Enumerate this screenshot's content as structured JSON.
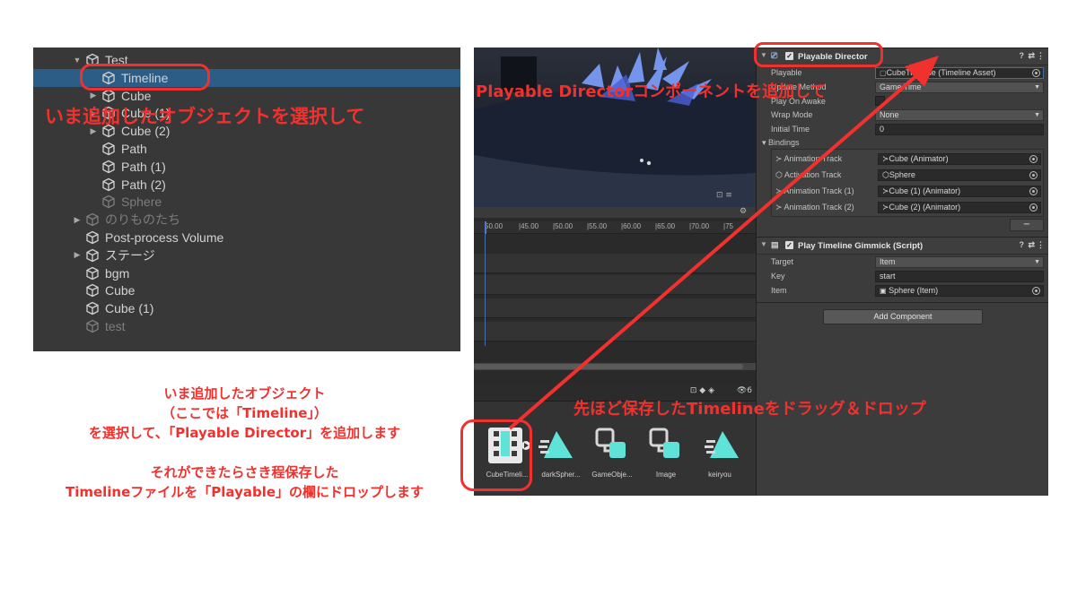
{
  "hierarchy": {
    "items": [
      {
        "label": "Test",
        "arrow": "▼",
        "indent": 0,
        "dim": false
      },
      {
        "label": "Timeline",
        "arrow": "",
        "indent": 1,
        "dim": false,
        "selected": true
      },
      {
        "label": "Cube",
        "arrow": "▶",
        "indent": 1,
        "dim": false
      },
      {
        "label": "Cube (1)",
        "arrow": "▶",
        "indent": 1,
        "dim": false
      },
      {
        "label": "Cube (2)",
        "arrow": "▶",
        "indent": 1,
        "dim": false
      },
      {
        "label": "Path",
        "arrow": "",
        "indent": 1,
        "dim": false
      },
      {
        "label": "Path (1)",
        "arrow": "",
        "indent": 1,
        "dim": false
      },
      {
        "label": "Path (2)",
        "arrow": "",
        "indent": 1,
        "dim": false
      },
      {
        "label": "Sphere",
        "arrow": "",
        "indent": 1,
        "dim": true
      },
      {
        "label": "のりものたち",
        "arrow": "▶",
        "indent": 0,
        "dim": true
      },
      {
        "label": "Post-process Volume",
        "arrow": "",
        "indent": 0,
        "dim": false
      },
      {
        "label": "ステージ",
        "arrow": "▶",
        "indent": 0,
        "dim": false
      },
      {
        "label": "bgm",
        "arrow": "",
        "indent": 0,
        "dim": false
      },
      {
        "label": "Cube",
        "arrow": "",
        "indent": 0,
        "dim": false
      },
      {
        "label": "Cube (1)",
        "arrow": "",
        "indent": 0,
        "dim": false
      },
      {
        "label": "test",
        "arrow": "",
        "indent": 0,
        "dim": true
      }
    ]
  },
  "timeline": {
    "ruler": [
      "50.00",
      "|45.00",
      "|50.00",
      "|55.00",
      "|60.00",
      "|65.00",
      "|70.00",
      "|75"
    ]
  },
  "project": {
    "search_count": "6",
    "assets": [
      {
        "label": "CubeTimeli...",
        "icon": "timeline-asset-icon"
      },
      {
        "label": "darkSpher...",
        "icon": "script-asset-icon"
      },
      {
        "label": "GameObje...",
        "icon": "prefab-asset-icon"
      },
      {
        "label": "Image",
        "icon": "prefab-asset-icon"
      },
      {
        "label": "keiryou",
        "icon": "script-asset-icon"
      }
    ]
  },
  "inspector": {
    "playable_director": {
      "title": "Playable Director",
      "playable_label": "Playable",
      "playable_value": "CubeTimeline (Timeline Asset)",
      "update_method_label": "Update Method",
      "update_method_value": "Game Time",
      "play_on_awake_label": "Play On Awake",
      "wrap_mode_label": "Wrap Mode",
      "wrap_mode_value": "None",
      "initial_time_label": "Initial Time",
      "initial_time_value": "0",
      "bindings_label": "Bindings",
      "bindings": [
        {
          "track": "Animation Track",
          "value": "Cube (Animator)"
        },
        {
          "track": "Activation Track",
          "value": "Sphere"
        },
        {
          "track": "Animation Track (1)",
          "value": "Cube (1) (Animator)"
        },
        {
          "track": "Animation Track (2)",
          "value": "Cube (2) (Animator)"
        }
      ],
      "minus": "−"
    },
    "gimmick": {
      "title": "Play Timeline Gimmick (Script)",
      "target_label": "Target",
      "target_value": "Item",
      "key_label": "Key",
      "key_value": "start",
      "item_label": "Item",
      "item_value": "Sphere (Item)"
    },
    "add_component": "Add Component"
  },
  "annotations": {
    "select_object": "いま追加したオブジェクトを選択して",
    "add_component": "Playable Directorコンポーネントを追加して",
    "drag_drop": "先ほど保存したTimelineをドラッグ＆ドロップ",
    "instructions": [
      "いま追加したオブジェクト",
      "（ここでは「Timeline」）",
      "を選択して、「Playable Director」を追加します",
      "",
      "それができたらさき程保存した",
      "Timelineファイルを「Playable」の欄にドロップします"
    ]
  },
  "colors": {
    "annotation_red": "#f0312e",
    "selection_blue": "#2c5d87",
    "asset_teal": "#5fe3d9"
  }
}
